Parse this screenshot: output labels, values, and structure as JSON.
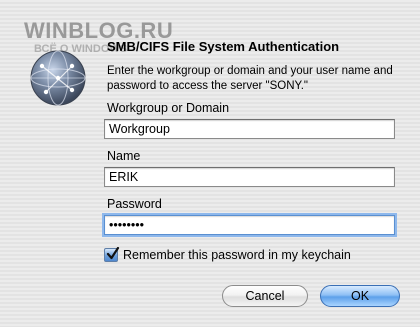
{
  "watermark": {
    "main": "WINBLOG.RU",
    "sub": "ВСЁ О WINDOWS"
  },
  "dialog": {
    "title": "SMB/CIFS File System Authentication",
    "description": "Enter the workgroup or domain and your user name and password to access the server \"SONY.\"",
    "icon": "network-globe-icon"
  },
  "fields": {
    "workgroup_label": "Workgroup or Domain",
    "workgroup_value": "Workgroup",
    "name_label": "Name",
    "name_value": "ERIK",
    "password_label": "Password",
    "password_value": "••••••••"
  },
  "remember": {
    "label": "Remember this password in my keychain",
    "checked": true
  },
  "buttons": {
    "cancel": "Cancel",
    "ok": "OK"
  },
  "colors": {
    "focus_ring": "#8eb8ec",
    "default_button": "#5da0ea"
  }
}
